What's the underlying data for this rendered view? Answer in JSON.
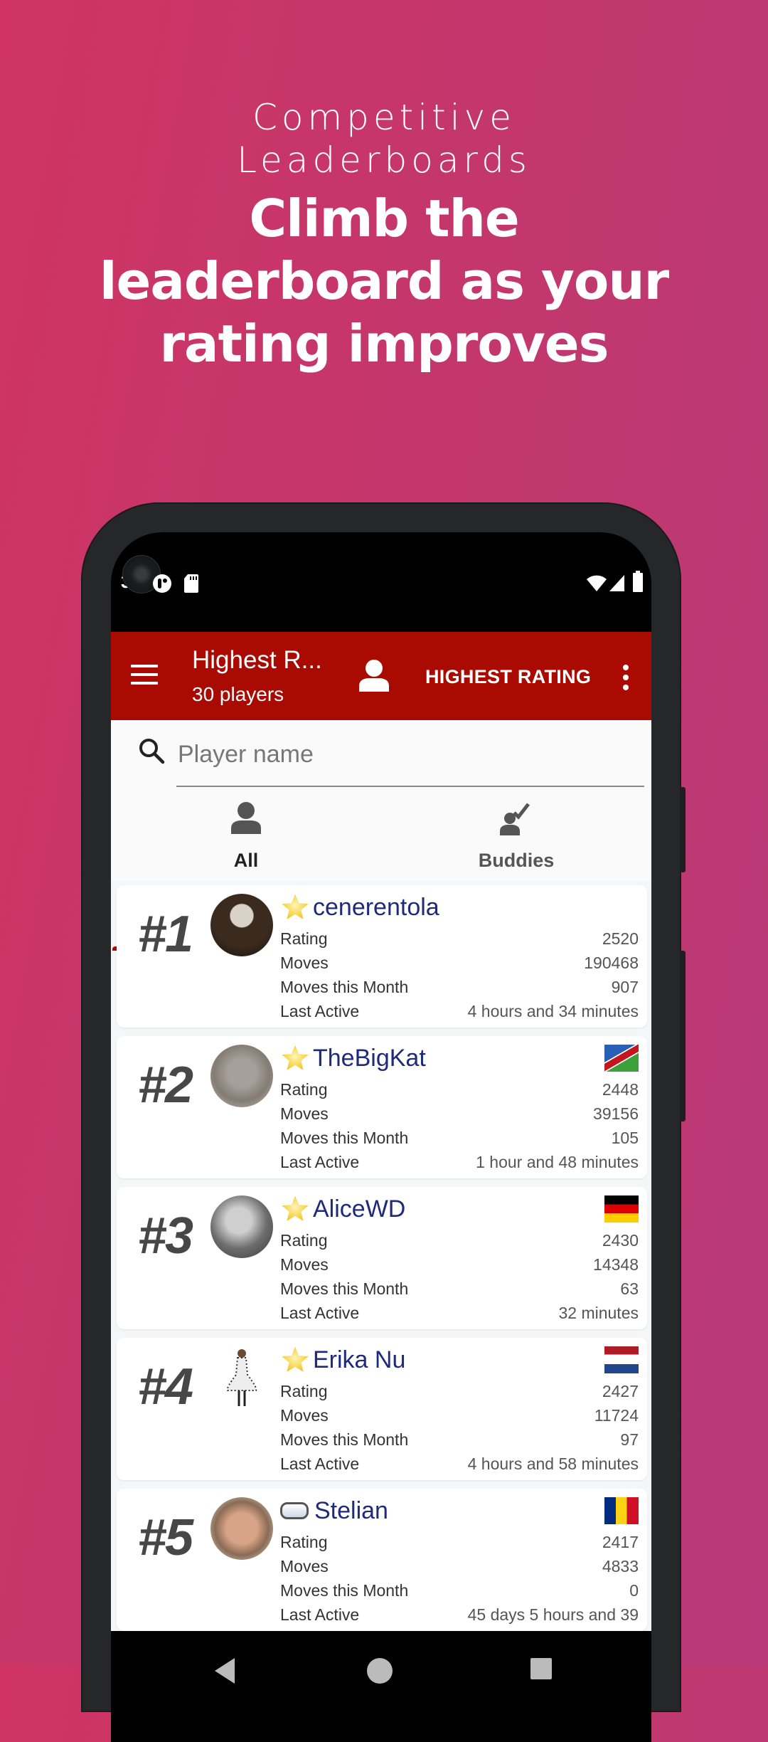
{
  "hero": {
    "subtitle_line1": "Competitive",
    "subtitle_line2": "Leaderboards",
    "title_line1": "Climb the",
    "title_line2": "leaderboard as your",
    "title_line3": "rating improves"
  },
  "status_bar": {
    "time": "3.",
    "icons": [
      "notification-app-icon",
      "sd-card-icon",
      "wifi-icon",
      "cell-signal-icon",
      "battery-icon"
    ]
  },
  "app_bar": {
    "title": "Highest R...",
    "subtitle": "30 players",
    "action_label": "HIGHEST RATING",
    "colors": {
      "primary": "#a90b03"
    }
  },
  "search": {
    "placeholder": "Player name",
    "value": ""
  },
  "tabs": [
    {
      "label": "All",
      "icon": "person-icon",
      "active": true
    },
    {
      "label": "Buddies",
      "icon": "person-check-icon",
      "active": false
    }
  ],
  "stat_labels": {
    "rating": "Rating",
    "moves": "Moves",
    "moves_month": "Moves this Month",
    "last_active": "Last Active"
  },
  "players": [
    {
      "rank": "#1",
      "name": "cenerentola",
      "badge": "star",
      "flag": "",
      "rating": "2520",
      "moves": "190468",
      "moves_month": "907",
      "last_active": "4 hours  and 34 minutes"
    },
    {
      "rank": "#2",
      "name": "TheBigKat",
      "badge": "star",
      "flag": "namibia",
      "rating": "2448",
      "moves": "39156",
      "moves_month": "105",
      "last_active": "1 hour  and 48 minutes"
    },
    {
      "rank": "#3",
      "name": "AliceWD",
      "badge": "star",
      "flag": "germany",
      "rating": "2430",
      "moves": "14348",
      "moves_month": "63",
      "last_active": "32 minutes"
    },
    {
      "rank": "#4",
      "name": "Erika Nu",
      "badge": "star",
      "flag": "netherlands",
      "rating": "2427",
      "moves": "11724",
      "moves_month": "97",
      "last_active": "4 hours  and 58 minutes"
    },
    {
      "rank": "#5",
      "name": "Stelian",
      "badge": "pill",
      "flag": "romania",
      "rating": "2417",
      "moves": "4833",
      "moves_month": "0",
      "last_active": "45 days 5 hours  and 39"
    }
  ]
}
